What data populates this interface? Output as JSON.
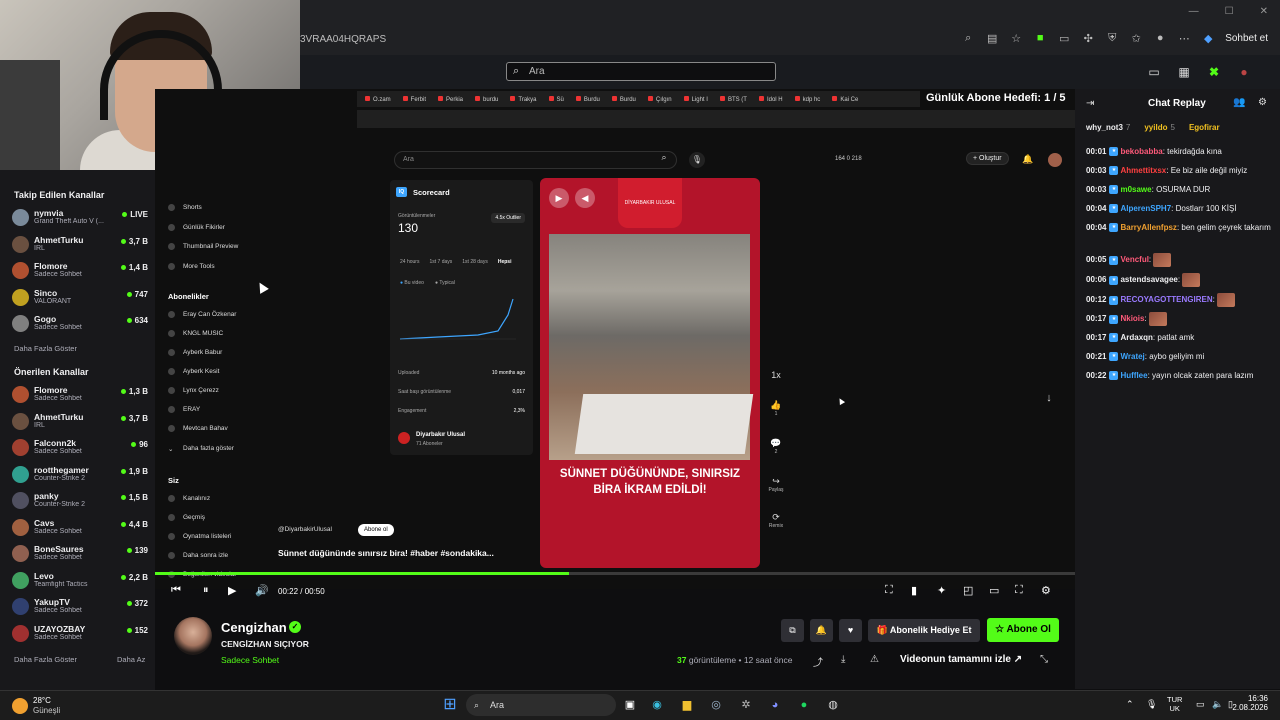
{
  "browser": {
    "url_fragment": "3VRAA04HQRAPS",
    "chat_button": "Sohbet et"
  },
  "kick": {
    "search_placeholder": "Ara"
  },
  "sidebar": {
    "followed_title": "Takip Edilen Kanallar",
    "followed": [
      {
        "name": "nymvia",
        "sub": "Grand Theft Auto V (...",
        "viewers": "LIVE",
        "color": "#7a8a9a"
      },
      {
        "name": "AhmetTurku",
        "sub": "IRL",
        "viewers": "3,7 B",
        "color": "#6a5040"
      },
      {
        "name": "Flomore",
        "sub": "Sadece Sohbet",
        "viewers": "1,4 B",
        "color": "#b05030"
      },
      {
        "name": "Sinco",
        "sub": "VALORANT",
        "viewers": "747",
        "color": "#c0a020"
      },
      {
        "name": "Gogo",
        "sub": "Sadece Sohbet",
        "viewers": "634",
        "color": "#808080"
      }
    ],
    "more1": "Daha Fazla Göster",
    "recommended_title": "Önerilen Kanallar",
    "recommended": [
      {
        "name": "Flomore",
        "sub": "Sadece Sohbet",
        "viewers": "1,3 B",
        "color": "#b05030"
      },
      {
        "name": "AhmetTurku",
        "sub": "IRL",
        "viewers": "3,7 B",
        "color": "#6a5040"
      },
      {
        "name": "Falconn2k",
        "sub": "Sadece Sohbet",
        "viewers": "96",
        "color": "#a04030"
      },
      {
        "name": "rootthegamer",
        "sub": "Counter-Strike 2",
        "viewers": "1,9 B",
        "color": "#30a090"
      },
      {
        "name": "panky",
        "sub": "Counter-Strike 2",
        "viewers": "1,5 B",
        "color": "#505060"
      },
      {
        "name": "Cavs",
        "sub": "Sadece Sohbet",
        "viewers": "4,4 B",
        "color": "#a06040"
      },
      {
        "name": "BoneSaures",
        "sub": "Sadece Sohbet",
        "viewers": "139",
        "color": "#906050"
      },
      {
        "name": "Levo",
        "sub": "Teamfight Tactics",
        "viewers": "2,2 B",
        "color": "#40a060"
      },
      {
        "name": "YakupTV",
        "sub": "Sadece Sohbet",
        "viewers": "372",
        "color": "#304070"
      },
      {
        "name": "UZAYOZBAY",
        "sub": "Sadece Sohbet",
        "viewers": "152",
        "color": "#a03030"
      }
    ],
    "more2": "Daha Fazla Göster",
    "less": "Daha Az"
  },
  "overlay": {
    "goal": "Günlük Abone Hedefi: 1 / 5"
  },
  "yt": {
    "tabs": [
      "O.zam",
      "Ferbit",
      "Perkia",
      "burdu",
      "Trakya",
      "Sü",
      "Burdu",
      "Burdu",
      "Çılgın",
      "Light I",
      "BTS (T",
      "Idol H",
      "kdp hc",
      "Kai Ce"
    ],
    "search_placeholder": "Ara",
    "stats": "164  0  218",
    "create": "+ Oluştur",
    "menu": [
      "Shorts",
      "Günlük Fikirler",
      "Thumbnail Preview",
      "More Tools"
    ],
    "subs_title": "Abonelikler",
    "subs": [
      "Eray Can Özkenar",
      "KNGL MUSIC",
      "Ayberk Babur",
      "Ayberk Kesit",
      "Lynx Çerezz",
      "ERAY",
      "Mevtcan Bahav"
    ],
    "subs_more": "Daha fazla göster",
    "you_title": "Siz",
    "you": [
      "Kanalınız",
      "Geçmiş",
      "Oynatma listeleri",
      "Daha sonra izle",
      "Beğenilen videolar"
    ],
    "score_title": "Scorecard",
    "views_label": "Görüntülenmeler",
    "views_value": "130",
    "outlier": "4.5x Outlier",
    "score_tabs": [
      "24 hours",
      "1st 7 days",
      "1st 28 days",
      "Hepsi"
    ],
    "legend": [
      "Bu video",
      "Typical"
    ],
    "uploaded_label": "Uploaded",
    "uploaded_value": "10 months ago",
    "ratio_label": "Saat başı görüntülenme",
    "ratio_value": "0,017",
    "engagement_label": "Engagement",
    "engagement_value": "2,3%",
    "channel_name": "Diyarbakır Ulusal",
    "channel_subs": "71 Aboneler",
    "caption": "SÜNNET DÜĞÜNÜNDE, SINIRSIZ BİRA İKRAM EDİLDİ!",
    "brand_text": "DİYARBAKIR ULUSAL",
    "handle": "@DiyarbakirUlusal",
    "subscribe": "Abone ol",
    "title": "Sünnet düğününde sınırsız bira! #haber #sondakika...",
    "likes": "1",
    "comments": "2",
    "share": "Paylaş",
    "remix": "Remix"
  },
  "player": {
    "time": "00:22 / 00:50",
    "progress": 0.45
  },
  "streamer": {
    "name": "Cengizhan",
    "title": "CENGİZHAN SIÇIYOR",
    "category": "Sadece Sohbet",
    "gift": "Abonelik Hediye Et",
    "subscribe": "Abone Ol",
    "views_count": "37",
    "views_text": "görüntüleme",
    "ago": "12 saat önce",
    "watch_full": "Videonun tamamını izle"
  },
  "chat": {
    "title": "Chat Replay",
    "top": [
      {
        "name": "why_not3",
        "count": "7",
        "color": "#efeff1"
      },
      {
        "name": "yyildo",
        "count": "5",
        "color": "#f0c020"
      },
      {
        "name": "Egofirar",
        "count": "",
        "color": "#f0c020"
      }
    ],
    "messages": [
      {
        "ts": "00:01",
        "user": "bekobabba",
        "color": "#ff5a7a",
        "text": "tekirdağda kına"
      },
      {
        "ts": "00:03",
        "user": "Ahmettitxsx",
        "color": "#ff4040",
        "text": "Ee biz aile değil miyiz"
      },
      {
        "ts": "00:03",
        "user": "m0sawe",
        "color": "#53fc18",
        "text": "OSURMA DUR"
      },
      {
        "ts": "00:04",
        "user": "AlperenSPH7",
        "color": "#3ea6ff",
        "text": "Dostlarr 100 KİŞİ"
      },
      {
        "ts": "00:04",
        "user": "BarryAllenfpsz",
        "color": "#f0a030",
        "text": "ben gelim çeyrek takarım"
      },
      {
        "ts": "00:05",
        "user": "Vencful",
        "color": "#ff5a7a",
        "text": ""
      },
      {
        "ts": "00:06",
        "user": "astendsavagee",
        "color": "#efeff1",
        "text": ""
      },
      {
        "ts": "00:12",
        "user": "RECOYAGOTTENGIREN",
        "color": "#9a7aff",
        "text": ""
      },
      {
        "ts": "00:17",
        "user": "Nkiois",
        "color": "#ff5a7a",
        "text": ""
      },
      {
        "ts": "00:17",
        "user": "Ardaxqn",
        "color": "#efeff1",
        "text": "patlat amk"
      },
      {
        "ts": "00:21",
        "user": "Wratej",
        "color": "#3ea6ff",
        "text": "aybo geliyim mi"
      },
      {
        "ts": "00:22",
        "user": "Hufflee",
        "color": "#3ea6ff",
        "text": "yayın olcak zaten para lazım"
      }
    ]
  },
  "taskbar": {
    "temp": "28°C",
    "condition": "Güneşli",
    "search": "Ara",
    "lang1": "TUR",
    "lang2": "UK",
    "time": "16:36",
    "date": "2.08.2026"
  }
}
